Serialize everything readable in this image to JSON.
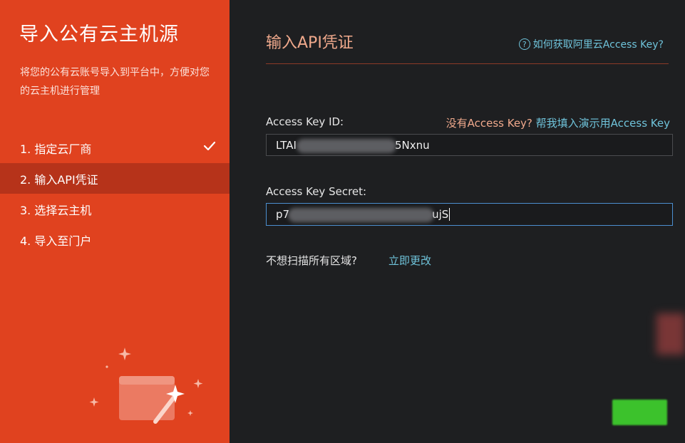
{
  "sidebar": {
    "title": "导入公有云主机源",
    "description": "将您的公有云账号导入到平台中，方便对您的云主机进行管理",
    "steps": [
      {
        "label": "1. 指定云厂商",
        "state": "done"
      },
      {
        "label": "2. 输入API凭证",
        "state": "active"
      },
      {
        "label": "3. 选择云主机",
        "state": "pending"
      },
      {
        "label": "4. 导入至门户",
        "state": "pending"
      }
    ],
    "color": "#e0421f",
    "active_color": "#b6331a"
  },
  "main": {
    "title": "输入API凭证",
    "help_link": "如何获取阿里云Access Key?",
    "help_icon": "question-circle-icon",
    "access_key_id": {
      "label": "Access Key ID:",
      "value_start": "LTAI",
      "value_end": "5Nxnu"
    },
    "demo_prompt": "没有Access Key?",
    "demo_link": "帮我填入演示用Access Key",
    "access_key_secret": {
      "label": "Access Key Secret:",
      "value_start": "p7",
      "value_end": "ujS"
    },
    "region_prompt": "不想扫描所有区域?",
    "region_link": "立即更改",
    "accent_color": "#f0a98c",
    "link_color": "#6fc3da"
  }
}
